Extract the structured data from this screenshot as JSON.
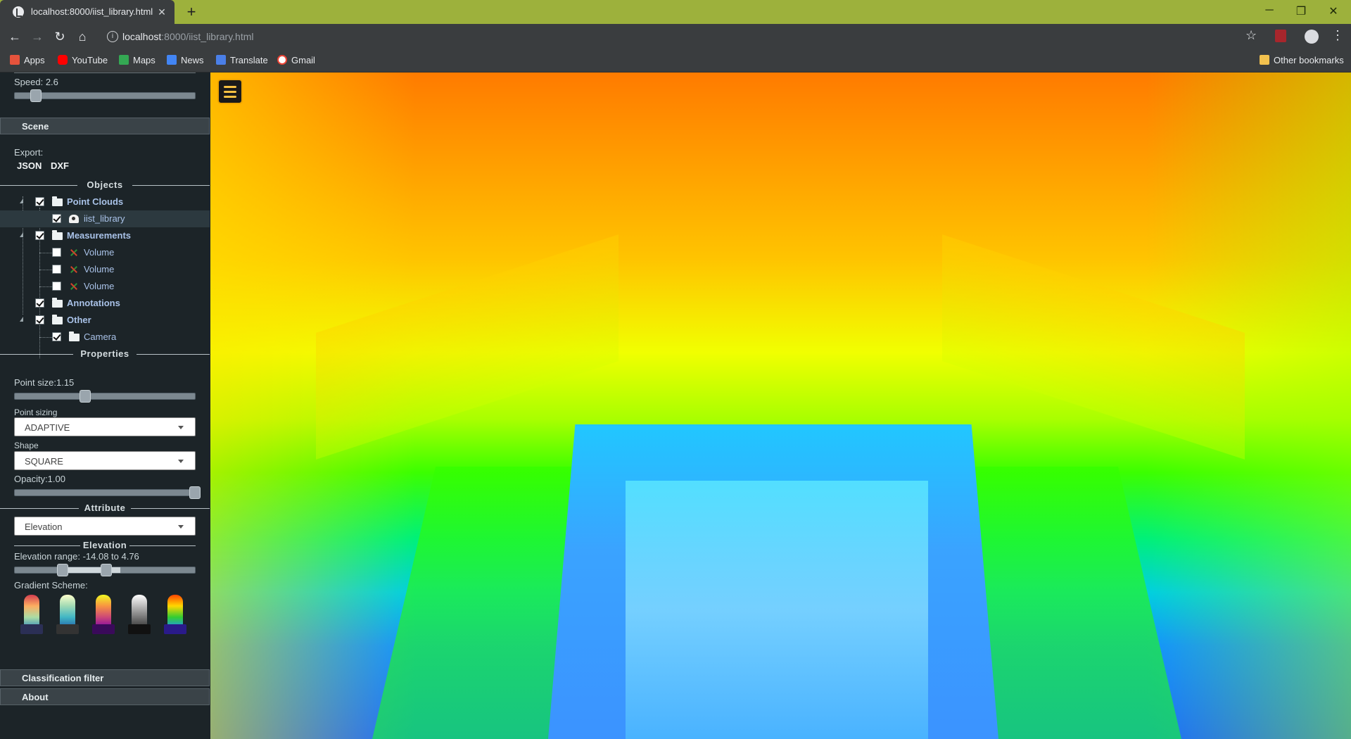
{
  "browser": {
    "tab_title": "localhost:8000/iist_library.html",
    "tab_close": "✕",
    "new_tab": "+",
    "url_host": "localhost",
    "url_rest": ":8000/iist_library.html",
    "window_controls": {
      "minimize": "─",
      "restore": "❐",
      "close": "✕"
    },
    "bookmarks": [
      {
        "label": "Apps",
        "icon": "apps-grid-icon",
        "color": "#e53935"
      },
      {
        "label": "YouTube",
        "icon": "youtube-icon",
        "color": "#ff0000"
      },
      {
        "label": "Maps",
        "icon": "maps-icon",
        "color": "#34a853"
      },
      {
        "label": "News",
        "icon": "news-icon",
        "color": "#4285f4"
      },
      {
        "label": "Translate",
        "icon": "translate-icon",
        "color": "#4285f4"
      },
      {
        "label": "Gmail",
        "icon": "google-icon",
        "color": "#ea4335"
      }
    ],
    "other_bookmarks": "Other bookmarks"
  },
  "sidebar": {
    "speed_label": "Speed: 2.6",
    "speed_fraction": 0.1,
    "scene_header": "Scene",
    "export_label": "Export:",
    "export_json": "JSON",
    "export_dxf": "DXF",
    "objects_header": "Objects",
    "tree": {
      "point_clouds": "Point Clouds",
      "iist_library": "iist_library",
      "measurements": "Measurements",
      "volume_1": "Volume",
      "volume_2": "Volume",
      "volume_3": "Volume",
      "annotations": "Annotations",
      "other": "Other",
      "camera": "Camera"
    },
    "properties_header": "Properties",
    "point_size_label": "Point size:1.15",
    "point_size_fraction": 0.38,
    "point_sizing_label": "Point sizing",
    "point_sizing_value": "ADAPTIVE",
    "shape_label": "Shape",
    "shape_value": "SQUARE",
    "opacity_label": "Opacity:1.00",
    "opacity_fraction": 1.0,
    "attribute_header": "Attribute",
    "attribute_value": "Elevation",
    "elevation_header": "Elevation",
    "elevation_range_label": "Elevation range: -14.08 to 4.76",
    "gradient_scheme_label": "Gradient Scheme:",
    "gradients": [
      {
        "name": "spectral-gradient-icon",
        "colors": [
          "#d53e4f",
          "#fdae61",
          "#abdda4",
          "#3288bd"
        ]
      },
      {
        "name": "yellow-green-gradient-icon",
        "colors": [
          "#ffffcc",
          "#a1dab4",
          "#41b6c4",
          "#225ea8"
        ]
      },
      {
        "name": "plasma-gradient-icon",
        "colors": [
          "#f0f921",
          "#f89441",
          "#cc4778",
          "#7e03a8"
        ]
      },
      {
        "name": "grayscale-gradient-icon",
        "colors": [
          "#ffffff",
          "#bbbbbb",
          "#777777",
          "#333333"
        ]
      },
      {
        "name": "rainbow-gradient-icon",
        "colors": [
          "#ff4500",
          "#ffd700",
          "#32cd32",
          "#1e90ff"
        ]
      }
    ],
    "classification_filter_header": "Classification filter",
    "about_header": "About"
  }
}
